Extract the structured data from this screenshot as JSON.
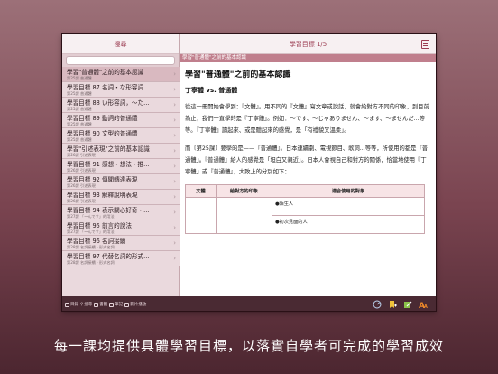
{
  "sidebar": {
    "title": "搜尋",
    "search_placeholder": "",
    "items": [
      {
        "title": "學習\"普通體\"之前的基本認識",
        "sub": "第25課 普通體"
      },
      {
        "title": "學習目標 87 名詞・な形容詞...",
        "sub": "第25課 普通體"
      },
      {
        "title": "學習目標 88 い形容詞，～た...",
        "sub": "第25課 普通體"
      },
      {
        "title": "學習目標 89 動詞的普通體",
        "sub": "第25課 普通體"
      },
      {
        "title": "學習目標 90 文型的普通體",
        "sub": "第25課 普通體"
      },
      {
        "title": "學習\"引述表現\"之前的基本認識",
        "sub": "第26課 引述表現"
      },
      {
        "title": "學習目標 91 感想・想法・推...",
        "sub": "第26課 引述表現"
      },
      {
        "title": "學習目標 92 傳聞轉達表現",
        "sub": "第26課 引述表現"
      },
      {
        "title": "學習目標 93 解釋說明表現",
        "sub": "第26課 引述表現"
      },
      {
        "title": "學習目標 94 表示關心好奇・...",
        "sub": "第27課 「～んです」的用法"
      },
      {
        "title": "學習目標 95 前言的說法",
        "sub": "第27課 「～んです」的用法"
      },
      {
        "title": "學習目標 96 名詞接續",
        "sub": "第28課 名詞接續・形式名詞"
      },
      {
        "title": "學習目標 97 代替名詞的形式...",
        "sub": "第28課 名詞接續・形式名詞"
      }
    ],
    "footer": [
      "目錄",
      "搜尋",
      "書籤",
      "筆記",
      "影片播放"
    ]
  },
  "main": {
    "title": "學習目標 1/5",
    "breadcrumb": "學習\"普通體\"之前的基本認識",
    "heading": "學習\"普通體\"之前的基本認識",
    "subheading": "丁寧體 vs. 普通體",
    "para1": "從這一冊開始會學到：『文體』。用不同的『文體』寫文章或說話，就會給對方不同的印象，到目前為止，我們一直學的是『丁寧體』。例如：～です、～じゃありません、～ます、～ませんだ...等等。『丁寧體』讀起來、或是聽起來的感覺，是「有禮貌又溫柔」。",
    "para2": "而〔第25課〕要學的是——『普通體』。日本連續劇、電視節目、歌詞...等等，所使用的都是『普通體』。『普通體』給人的感覺是「坦白又親近」。日本人會視自己和對方的關係，恰當地使用『丁寧體』或『普通體』，大致上的分別如下：",
    "table": {
      "headers": [
        "文體",
        "給對方的印象",
        "適合使用的對象"
      ],
      "row1": [
        "",
        "",
        "●陌生人"
      ],
      "row2": [
        "",
        "",
        "●初次見面的人"
      ]
    }
  },
  "caption": "每一課均提供具體學習目標，以落實自學者可完成的學習成效",
  "colors": {
    "accent": "#9c3d52",
    "breadcrumb": "#c07f8d",
    "footer": "#4a2a33"
  }
}
